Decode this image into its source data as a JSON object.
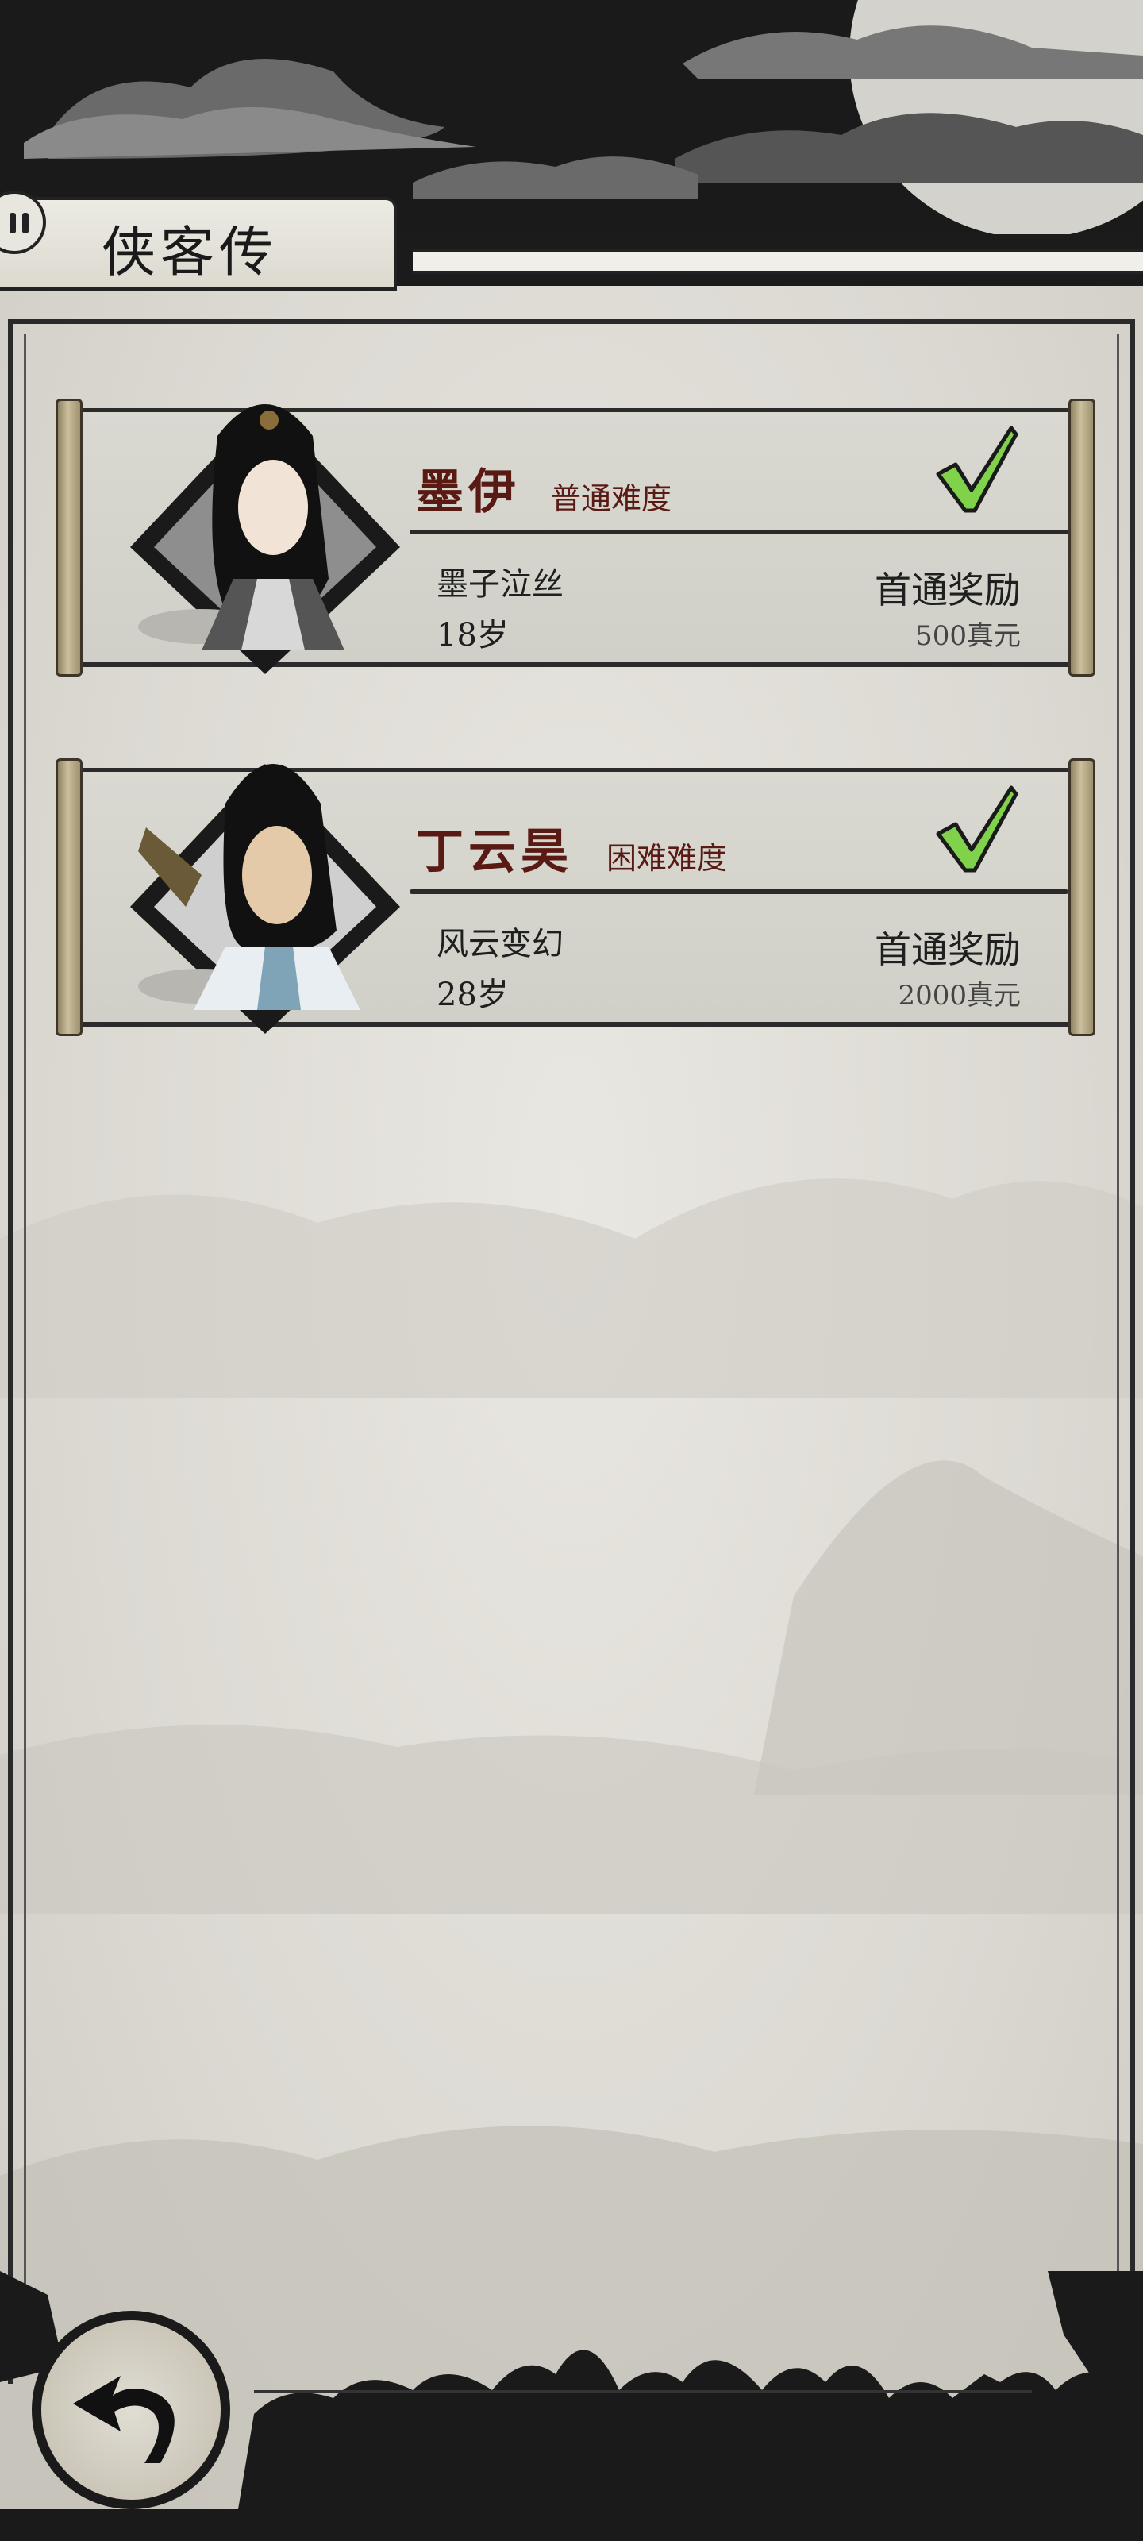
{
  "header": {
    "title": "侠客传"
  },
  "characters": [
    {
      "name": "墨伊",
      "difficulty": "普通难度",
      "subtitle": "墨子泣丝",
      "age": "18岁",
      "reward_label": "首通奖励",
      "reward_value": "500真元",
      "completed": true
    },
    {
      "name": "丁云昊",
      "difficulty": "困难难度",
      "subtitle": "风云变幻",
      "age": "28岁",
      "reward_label": "首通奖励",
      "reward_value": "2000真元",
      "completed": true
    }
  ],
  "icons": {
    "menu": "pause-icon",
    "check": "check-icon",
    "back": "back-arrow-icon"
  },
  "colors": {
    "name": "#5a1a14",
    "check": "#7fd24a",
    "ink": "#1a1a1a"
  }
}
